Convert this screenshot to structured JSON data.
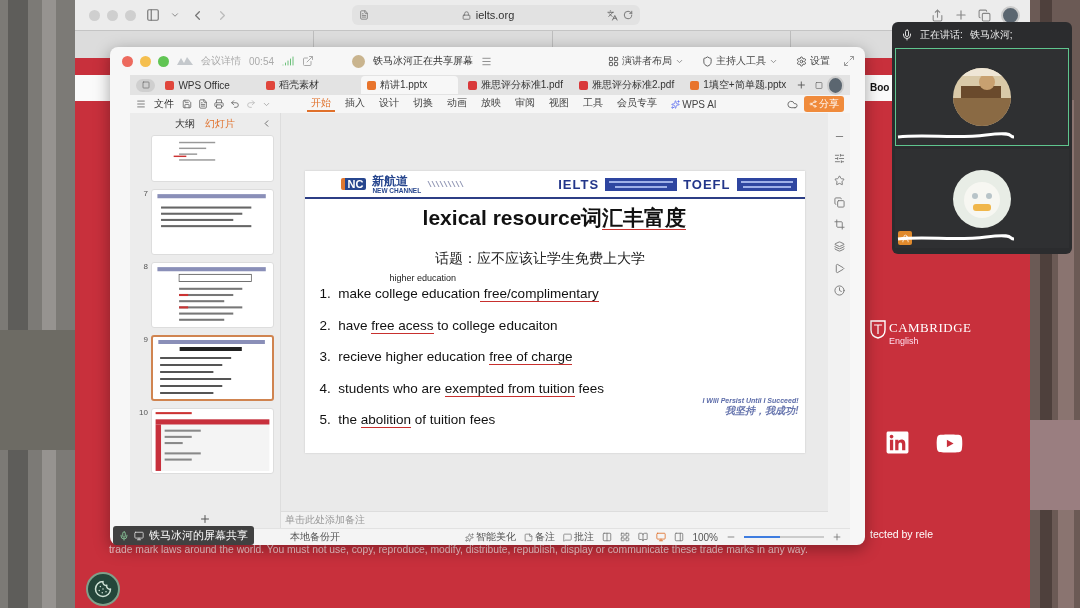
{
  "browser": {
    "address": "ielts.org"
  },
  "page": {
    "nav_link": "Boo",
    "brand": {
      "name": "CAMBRIDGE",
      "sub": "English"
    },
    "footer_fragment": "tected by rele",
    "footer_line": "trade mark laws around the world. You must not use, copy, reproduce, modify, distribute, republish, display or communicate these trade marks in any way."
  },
  "meeting": {
    "details": "会议详情",
    "timer": "00:54",
    "sharing_notice": "铁马冰河正在共享屏幕",
    "controls": [
      {
        "kind": "layout",
        "label": "演讲者布局"
      },
      {
        "kind": "host",
        "label": "主持人工具"
      },
      {
        "kind": "settings",
        "label": "设置"
      }
    ],
    "share_label": "铁马冰河的屏幕共享"
  },
  "wps": {
    "tabs": [
      {
        "label": "WPS Office",
        "selected": false,
        "color": "#e0463c"
      },
      {
        "label": "稻壳素材",
        "selected": false,
        "color": "#e0463c"
      },
      {
        "label": "精讲1.pptx",
        "selected": true,
        "color": "#e8742c"
      },
      {
        "label": "雅思评分标准1.pdf",
        "selected": false,
        "color": "#d9383a"
      },
      {
        "label": "雅思评分标准2.pdf",
        "selected": false,
        "color": "#d9383a"
      },
      {
        "label": "1填空+简单题.pptx",
        "selected": false,
        "color": "#e8742c"
      }
    ],
    "file_menu": "文件",
    "ribbon": [
      {
        "label": "开始",
        "selected": true
      },
      {
        "label": "插入",
        "selected": false
      },
      {
        "label": "设计",
        "selected": false
      },
      {
        "label": "切换",
        "selected": false
      },
      {
        "label": "动画",
        "selected": false
      },
      {
        "label": "放映",
        "selected": false
      },
      {
        "label": "审阅",
        "selected": false
      },
      {
        "label": "视图",
        "selected": false
      },
      {
        "label": "工具",
        "selected": false
      },
      {
        "label": "会员专享",
        "selected": false
      }
    ],
    "ai_label": "WPS AI",
    "share": "分享",
    "panel_tabs": [
      {
        "label": "大纲",
        "selected": false
      },
      {
        "label": "幻灯片",
        "selected": true
      }
    ],
    "slides": [
      {
        "kind": "bullets",
        "selected": false
      },
      {
        "number": "7",
        "kind": "text",
        "selected": false
      },
      {
        "number": "8",
        "kind": "list",
        "selected": false
      },
      {
        "number": "9",
        "kind": "lexical",
        "selected": true
      },
      {
        "number": "10",
        "kind": "table",
        "selected": false
      }
    ],
    "notes_placeholder": "单击此处添加备注",
    "status": {
      "backup": "本地备份开",
      "beautify": "智能美化",
      "notes": "备注",
      "comments": "批注",
      "zoom": "100%",
      "zoom_slider": {
        "level": 0.45
      }
    }
  },
  "slide": {
    "mark": "NC",
    "brand_cn": "新航道",
    "brand_en": "NEW CHANNEL",
    "exams": [
      "IELTS",
      "TOEFL"
    ],
    "title": [
      {
        "text": "lexical resource词",
        "marked": false
      },
      {
        "text": "汇丰富度",
        "marked": true
      }
    ],
    "topic": "话题：应不应该让学生免费上大学",
    "note": "higher education",
    "items": [
      {
        "number": "1.",
        "parts": [
          {
            "text": "make college education",
            "marked": false
          },
          {
            "text": " free/complimentary",
            "marked": true
          }
        ]
      },
      {
        "number": "2.",
        "parts": [
          {
            "text": "have ",
            "marked": false
          },
          {
            "text": "free acess",
            "marked": true
          },
          {
            "text": " to college educaiton",
            "marked": false
          }
        ]
      },
      {
        "number": "3.",
        "parts": [
          {
            "text": "recieve higher education ",
            "marked": false
          },
          {
            "text": "free of charge",
            "marked": true
          }
        ]
      },
      {
        "number": "4.",
        "parts": [
          {
            "text": "students who are ",
            "marked": false
          },
          {
            "text": "exempted from tuition",
            "marked": true
          },
          {
            "text": " fees",
            "marked": false
          }
        ]
      },
      {
        "number": "5.",
        "parts": [
          {
            "text": "the ",
            "marked": false
          },
          {
            "text": "abolition",
            "marked": true
          },
          {
            "text": " of tuition fees",
            "marked": false
          }
        ]
      }
    ],
    "motto": "I Will Persist Until I Succeed!",
    "motto_cn": "我坚持，我成功!"
  },
  "speakers": {
    "label": "正在讲话:",
    "name": "铁马冰河;",
    "tiles": [
      {
        "active": true
      },
      {
        "active": false
      }
    ]
  }
}
